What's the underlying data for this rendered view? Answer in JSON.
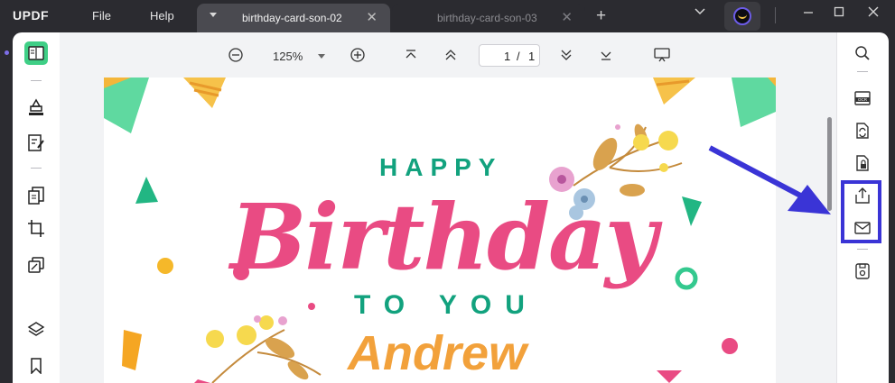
{
  "app": {
    "logo": "UPDF",
    "menu": [
      "File",
      "Help"
    ]
  },
  "tabs": [
    {
      "label": "birthday-card-son-02",
      "active": true
    },
    {
      "label": "birthday-card-son-03",
      "active": false
    }
  ],
  "window_controls": {
    "dropdown": "chevron-down-icon",
    "minimize": "minimize-icon",
    "maximize": "maximize-icon",
    "close": "close-icon"
  },
  "toolbar": {
    "zoom_value": "125%",
    "page_current": "1",
    "page_separator": "/",
    "page_total": "1"
  },
  "left_tools": [
    "reader-icon",
    "comment-icon",
    "edit-icon",
    "organize-icon",
    "crop-icon",
    "page-tools-icon",
    "layers-icon",
    "bookmark-icon"
  ],
  "right_tools": [
    "search-icon",
    "ocr-icon",
    "convert-icon",
    "protect-icon",
    "share-icon",
    "email-icon",
    "save-icon"
  ],
  "document": {
    "line1": "HAPPY",
    "line2": "Birthday",
    "line3": "TO YOU",
    "name": "Andrew"
  },
  "colors": {
    "accent_purple": "#7d6ee8",
    "highlight": "#3a34d6",
    "green_text": "#12a27e",
    "pink_text": "#e94b83",
    "orange_text": "#f2a13b"
  }
}
